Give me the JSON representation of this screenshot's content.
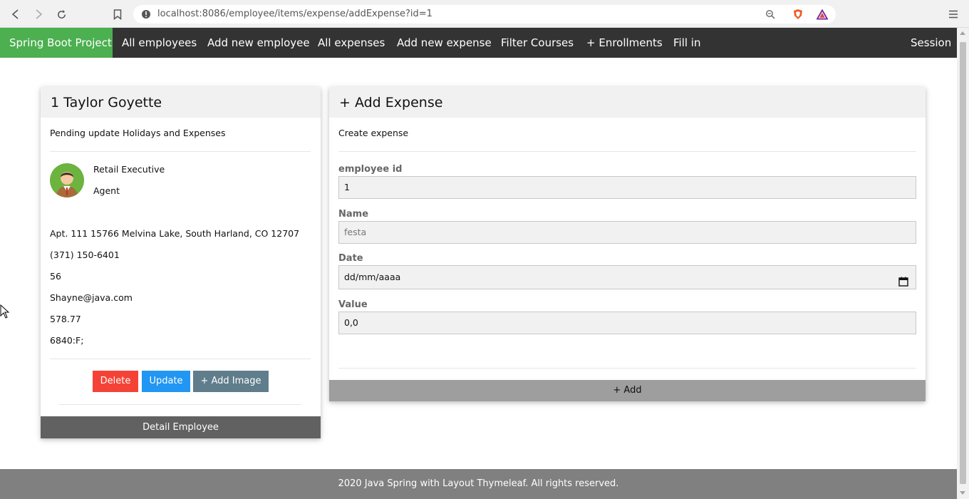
{
  "browser": {
    "url": "localhost:8086/employee/items/expense/addExpense?id=1"
  },
  "navbar": {
    "brand": "Spring Boot Project",
    "items": [
      "All employees",
      "Add new employee",
      "All expenses",
      "Add new expense",
      "Filter Courses",
      "+ Enrollments",
      "Fill in"
    ],
    "session": "Session",
    "brand_color": "#4caf50",
    "bg_color": "#333333"
  },
  "employee_card": {
    "title": "1 Taylor Goyette",
    "subtitle": "Pending update Holidays and Expenses",
    "job_title": "Retail Executive",
    "role": "Agent",
    "address": "Apt. 111 15766 Melvina Lake, South Harland, CO 12707",
    "phone": "(371) 150-6401",
    "age": "56",
    "email": "Shayne@java.com",
    "salary": "578.77",
    "code": "6840:F;",
    "buttons": {
      "delete": "Delete",
      "update": "Update",
      "add_image": "+ Add Image"
    },
    "footer": "Detail Employee"
  },
  "expense_card": {
    "title": "+ Add Expense",
    "subtitle": "Create expense",
    "fields": {
      "employee_id": {
        "label": "employee id",
        "value": "1"
      },
      "name": {
        "label": "Name",
        "placeholder": "festa"
      },
      "date": {
        "label": "Date",
        "value": "dd/mm/aaaa"
      },
      "value": {
        "label": "Value",
        "value": "0,0"
      }
    },
    "submit": "+ Add"
  },
  "footer": {
    "text": "2020 Java Spring with Layout Thymeleaf. All rights reserved."
  },
  "colors": {
    "delete": "#f44336",
    "update": "#2196f3",
    "add_image": "#607d8b",
    "card_footer": "#616161",
    "submit_bar": "#9e9e9e",
    "page_footer": "#808080"
  }
}
